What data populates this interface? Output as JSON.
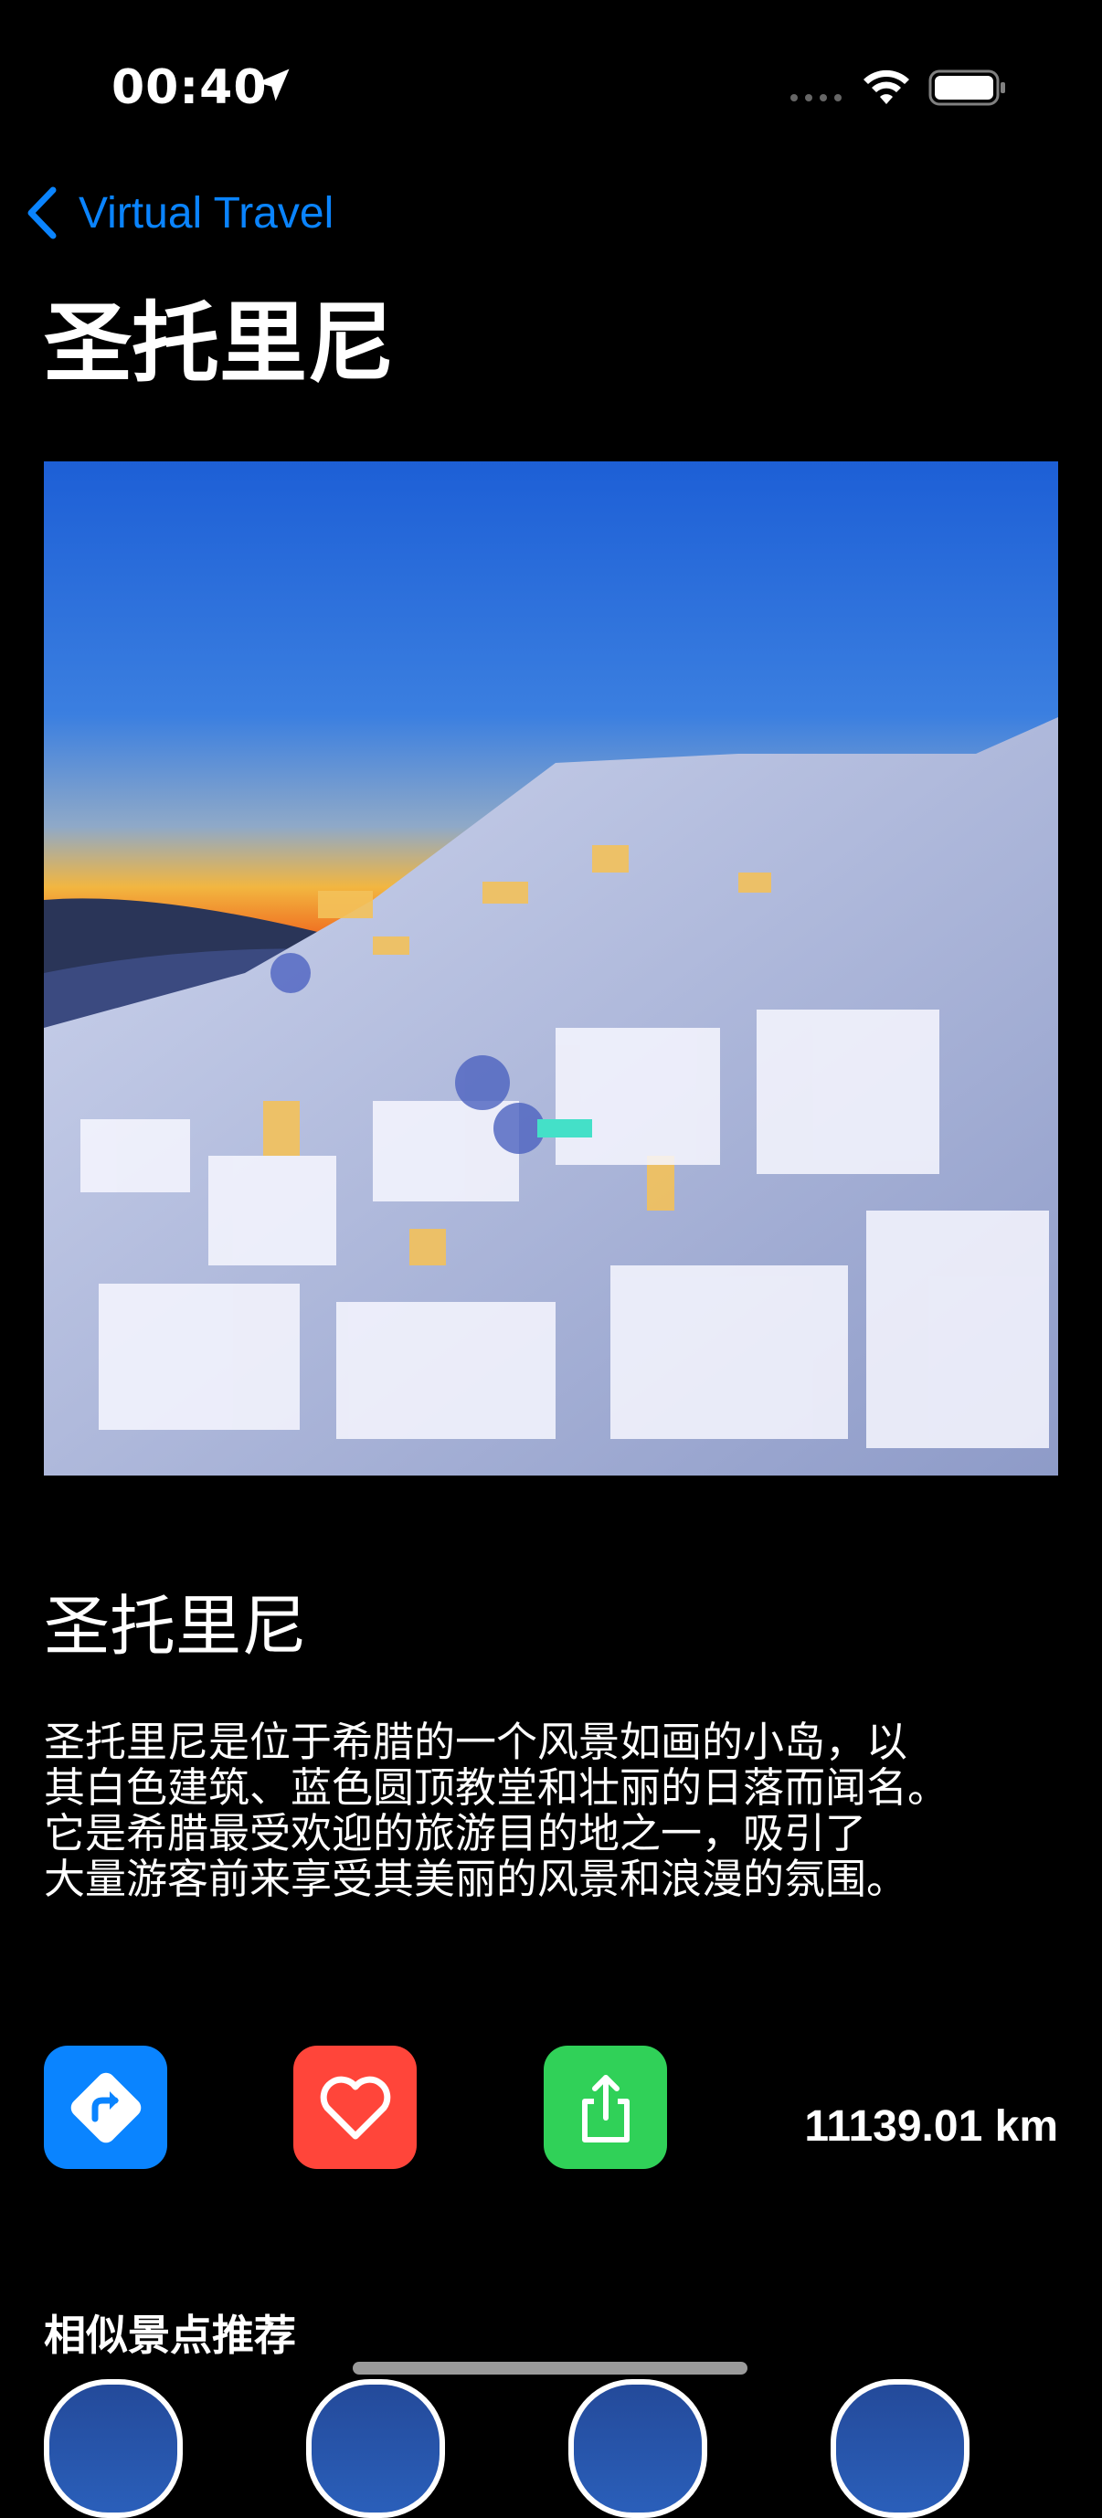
{
  "status_bar": {
    "time": "00:40"
  },
  "nav": {
    "back_label": "Virtual Travel",
    "large_title": "圣托里尼"
  },
  "hero": {
    "alt": "Santorini at sunset"
  },
  "detail": {
    "title": "圣托里尼",
    "description": "圣托里尼是位于希腊的一个风景如画的小岛，以\n其白色建筑、蓝色圆顶教堂和壮丽的日落而闻名。\n它是希腊最受欢迎的旅游目的地之一，吸引了\n大量游客前来享受其美丽的风景和浪漫的氛围。"
  },
  "actions": {
    "directions": {
      "icon": "directions-icon",
      "color": "#0a84ff"
    },
    "favorite": {
      "icon": "heart-icon",
      "color": "#ff453a"
    },
    "share": {
      "icon": "share-icon",
      "color": "#30d158"
    },
    "distance": "11139.01 km"
  },
  "similar": {
    "title": "相似景点推荐",
    "count_visible": 4
  }
}
